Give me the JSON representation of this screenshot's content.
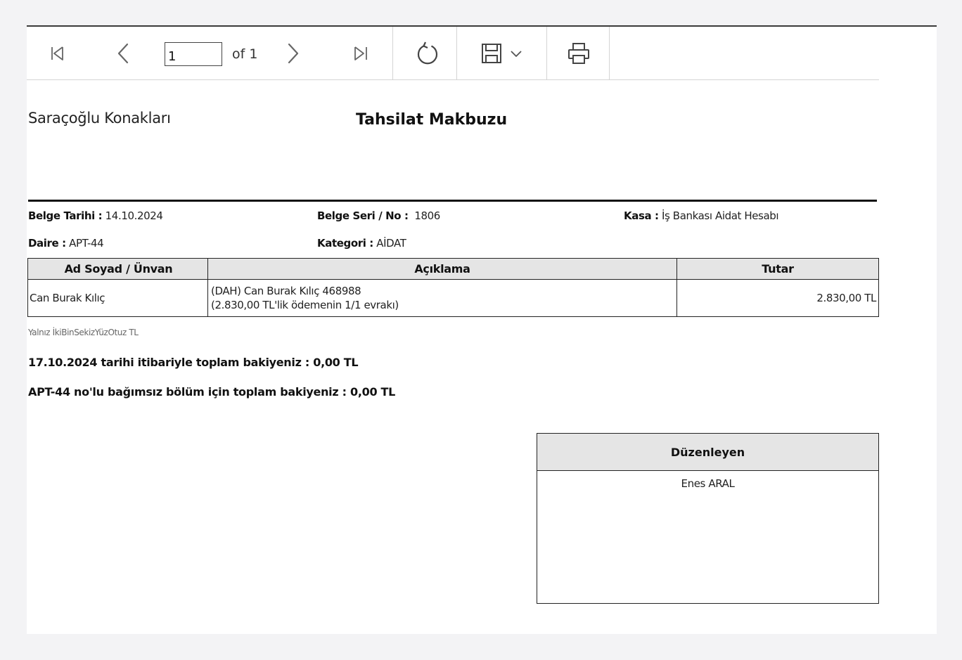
{
  "toolbar": {
    "page_current": "1",
    "page_of": "of 1",
    "icons": [
      "first-page-icon",
      "previous-page-icon",
      "next-page-icon",
      "last-page-icon",
      "refresh-icon",
      "save-icon",
      "chevron-down-icon",
      "print-icon"
    ]
  },
  "report": {
    "company": "Saraçoğlu Konakları",
    "title": "Tahsilat Makbuzu",
    "fields": {
      "belge_tarihi_label": "Belge Tarihi :",
      "belge_tarihi_value": " 14.10.2024",
      "belge_seri_label": "Belge Seri / No :",
      "belge_seri_value": "  1806",
      "kasa_label": "Kasa :",
      "kasa_value": " İş Bankası Aidat Hesabı",
      "daire_label": "Daire :",
      "daire_value": " APT-44",
      "kategori_label": "Kategori :",
      "kategori_value": " AİDAT"
    },
    "table": {
      "headers": [
        "Ad Soyad / Ünvan",
        "Açıklama",
        "Tutar"
      ],
      "rows": [
        {
          "name": "Can Burak Kılıç",
          "desc_line1": "(DAH) Can Burak Kılıç 468988",
          "desc_line2": "(2.830,00 TL'lik ödemenin 1/1 evrakı)",
          "amount": "2.830,00 TL"
        }
      ]
    },
    "amount_in_words": "Yalnız İkiBinSekizYüzOtuz TL",
    "balance_date_line": "17.10.2024 tarihi itibariyle toplam bakiyeniz : 0,00 TL",
    "balance_unit_line": "APT-44 no'lu bağımsız bölüm için toplam bakiyeniz : 0,00 TL",
    "signature": {
      "header": "Düzenleyen",
      "name": "Enes ARAL"
    }
  }
}
